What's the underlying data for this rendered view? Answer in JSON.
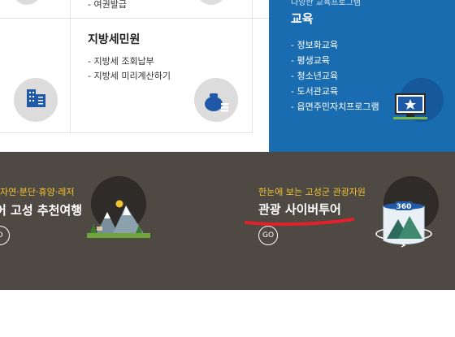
{
  "card_top": {
    "partial_item": "- 여권발급"
  },
  "local_tax": {
    "title": "지방세민원",
    "items": [
      "- 지방세 조회납부",
      "- 지방세 미리계산하기"
    ]
  },
  "education": {
    "subtitle": "다양한 교육프로그램",
    "title": "교육",
    "items": [
      "- 정보화교육",
      "- 평생교육",
      "- 청소년교육",
      "- 도서관교육",
      "- 읍면주민자치프로그램"
    ]
  },
  "banner_left": {
    "category": "자연·분단·휴양·레저",
    "title": "어 고성 추천여행",
    "go_label": "O"
  },
  "banner_right": {
    "category": "한눈에 보는 고성군 관광자원",
    "title": "관광 사이버투어",
    "go_label": "GO",
    "icon_text": "360"
  },
  "colors": {
    "education_panel": "#1a6cb0",
    "banner_background": "#4f4944",
    "category_text": "#f2c530",
    "highlight_underline": "#e2202a"
  }
}
